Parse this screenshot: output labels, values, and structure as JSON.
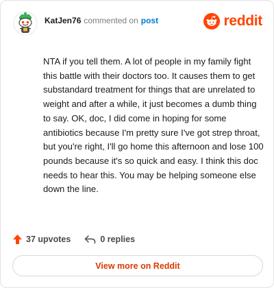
{
  "header": {
    "username": "KatJen76",
    "commented_on_text": "commented on",
    "post_link_label": "post",
    "brand_name": "reddit",
    "avatar_icon": "snoo-avatar-icon",
    "brand_icon": "reddit-logo-icon"
  },
  "comment": {
    "body": "NTA if you tell them. A lot of people in my family fight this battle with their doctors too. It causes them to get substandard treatment for things that are unrelated to weight and after a while, it just becomes a dumb thing to say. OK, doc, I did come in hoping for some antibiotics because I'm pretty sure I've got strep throat, but you're right, I'll go home this afternoon and lose 100 pounds because it's so quick and easy. I think this doc needs to hear this. You may be helping someone else down the line."
  },
  "actions": {
    "upvotes_label": "37 upvotes",
    "replies_label": "0 replies",
    "upvote_icon": "upvote-arrow-icon",
    "reply_icon": "reply-arrow-icon"
  },
  "footer": {
    "view_more_label": "View more on Reddit"
  },
  "colors": {
    "brand": "#ff4500",
    "link": "#0079d3",
    "view_more_text": "#d93a00",
    "text": "#1a1a1b",
    "muted": "#7c7c7c"
  }
}
